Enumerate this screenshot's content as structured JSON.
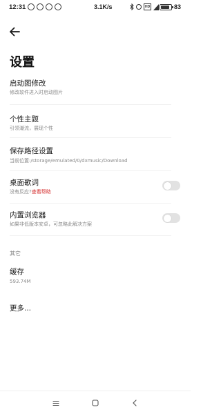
{
  "status_bar": {
    "time": "12:31",
    "left_icons": [
      "wechat-icon",
      "notification-icon",
      "sync-icon",
      "alarm-icon"
    ],
    "network_speed": "3.1K/s",
    "right_icons": [
      "bluetooth-icon",
      "alarm-clock-icon",
      "hd-icon",
      "signal-icon",
      "hd-icon",
      "signal-icon",
      "wifi-icon"
    ],
    "battery_percent": "83",
    "battery_level": 0.83
  },
  "header": {
    "back_icon": "arrow-left-icon",
    "title": "设置"
  },
  "settings": {
    "items": [
      {
        "title": "启动图修改",
        "subtitle": "修改软件进入时启动图片"
      },
      {
        "title": "个性主题",
        "subtitle": "引领潮流，展现个性"
      },
      {
        "title": "保存路径设置",
        "subtitle": "当前位置:/storage/emulated/0/dxmusic/Download"
      },
      {
        "title": "桌面歌词",
        "subtitle_prefix": "没有反应?",
        "subtitle_link": "查看帮助",
        "toggle": false
      },
      {
        "title": "内置浏览器",
        "subtitle": "如果非低版本安卓，可忽略此解决方案",
        "toggle": false
      }
    ]
  },
  "other": {
    "section_label": "其它",
    "cache_title": "缓存",
    "cache_size": "593.74M",
    "more_label": "更多..."
  },
  "nav_bar": {
    "icons": [
      "menu-icon",
      "home-icon",
      "back-icon"
    ]
  },
  "colors": {
    "link": "#d42a2a",
    "toggle_off": "#e2e2e2",
    "subtitle": "#8a8a8a"
  }
}
